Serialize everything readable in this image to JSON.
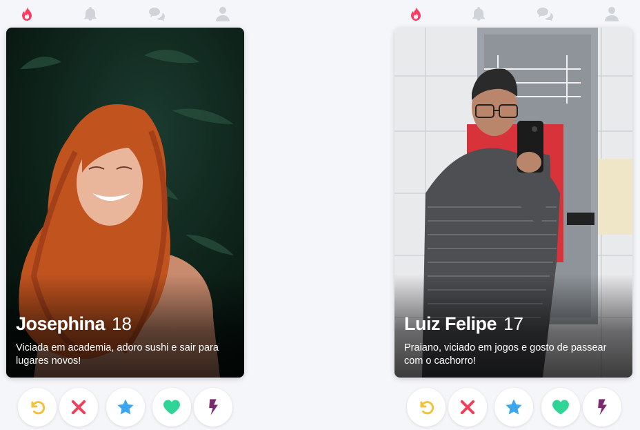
{
  "colors": {
    "accent": "#fd3a61",
    "nav_inactive": "#d0d3d9",
    "undo": "#f2c23b",
    "nope": "#f0405c",
    "super_like": "#3ba6f0",
    "like": "#2fd597",
    "boost": "#7a2a6f"
  },
  "nav": {
    "icons": [
      "flame-icon",
      "bell-icon",
      "chat-icon",
      "profile-icon"
    ]
  },
  "profiles": [
    {
      "name": "Josephina",
      "age": "18",
      "bio": "Viciada em academia, adoro sushi e sair para lugares novos!"
    },
    {
      "name": "Luiz Felipe",
      "age": "17",
      "bio": "Praiano, viciado em jogos e gosto de passear com o cachorro!"
    }
  ],
  "actions": [
    "undo-icon",
    "nope-icon",
    "super-like-icon",
    "like-icon",
    "boost-icon"
  ]
}
